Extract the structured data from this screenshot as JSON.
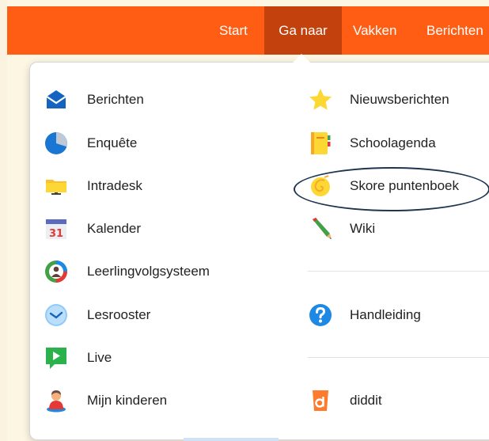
{
  "nav": {
    "start": "Start",
    "ga_naar": "Ga naar",
    "vakken": "Vakken",
    "berichten": "Berichten"
  },
  "menu": {
    "left": [
      {
        "label": "Berichten",
        "icon": "envelope-icon"
      },
      {
        "label": "Enquête",
        "icon": "pie-chart-icon"
      },
      {
        "label": "Intradesk",
        "icon": "folder-icon"
      },
      {
        "label": "Kalender",
        "icon": "calendar-icon"
      },
      {
        "label": "Leerlingvolgsysteem",
        "icon": "student-tracking-icon"
      },
      {
        "label": "Lesrooster",
        "icon": "clock-icon"
      },
      {
        "label": "Live",
        "icon": "chat-play-icon"
      },
      {
        "label": "Mijn kinderen",
        "icon": "child-icon"
      }
    ],
    "right": [
      {
        "label": "Nieuwsberichten",
        "icon": "star-icon"
      },
      {
        "label": "Schoolagenda",
        "icon": "notebook-icon"
      },
      {
        "label": "Skore puntenboek",
        "icon": "shell-icon"
      },
      {
        "label": "Wiki",
        "icon": "pencil-icon"
      },
      {
        "label": "Handleiding",
        "icon": "help-icon"
      },
      {
        "label": "diddit",
        "icon": "diddit-icon"
      }
    ],
    "calendar_day": "31"
  },
  "colors": {
    "topbar": "#fe5d13",
    "active_tab": "#c2410c",
    "annotation": "#1d3550"
  }
}
